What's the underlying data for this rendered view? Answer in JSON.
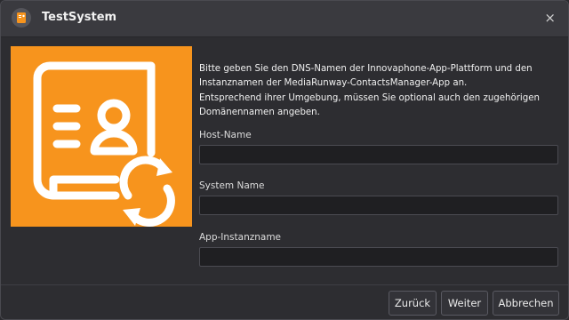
{
  "window": {
    "title": "TestSystem",
    "close_glyph": "×",
    "app_icon": "contacts-book-icon",
    "accent_color": "#f7941d"
  },
  "main": {
    "description": "Bitte geben Sie den DNS-Namen der Innovaphone-App-Plattform und den Instanznamen der MediaRunway-ContactsManager-App an.\nEntsprechend ihrer Umgebung, müssen Sie optional auch den zugehörigen Domänennamen angeben.",
    "illustration": "contacts-book-sync-icon",
    "fields": [
      {
        "label": "Host-Name",
        "value": "",
        "placeholder": ""
      },
      {
        "label": "System Name",
        "value": "",
        "placeholder": ""
      },
      {
        "label": "App-Instanzname",
        "value": "",
        "placeholder": ""
      }
    ]
  },
  "footer": {
    "back_label": "Zurück",
    "next_label": "Weiter",
    "cancel_label": "Abbrechen"
  }
}
